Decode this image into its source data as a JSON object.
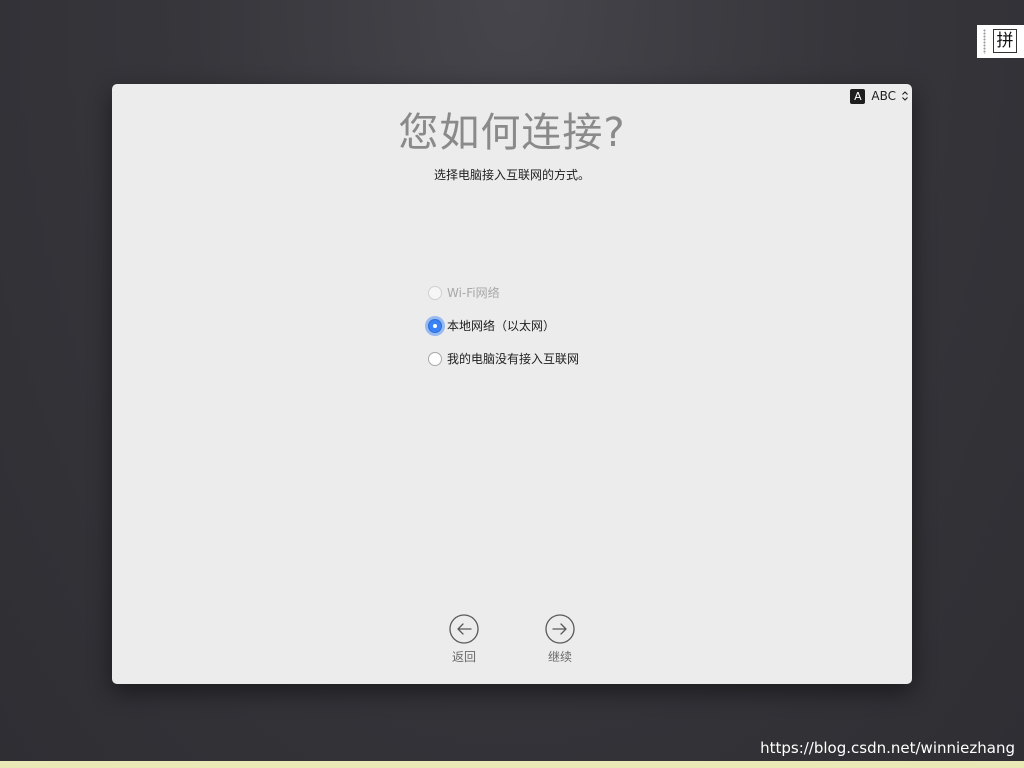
{
  "ime_indicator": {
    "char": "拼"
  },
  "input_source": {
    "badge": "A",
    "label": "ABC"
  },
  "page": {
    "title": "您如何连接?",
    "subtitle": "选择电脑接入互联网的方式。"
  },
  "options": [
    {
      "label": "Wi-Fi网络",
      "state": "disabled"
    },
    {
      "label": "本地网络（以太网）",
      "state": "selected"
    },
    {
      "label": "我的电脑没有接入互联网",
      "state": "unselected"
    }
  ],
  "nav": {
    "back_label": "返回",
    "continue_label": "继续"
  },
  "watermark": "https://blog.csdn.net/winniezhang",
  "colors": {
    "accent": "#3a82f7",
    "window_bg": "#ececec",
    "title_gray": "#8a8a8a"
  }
}
